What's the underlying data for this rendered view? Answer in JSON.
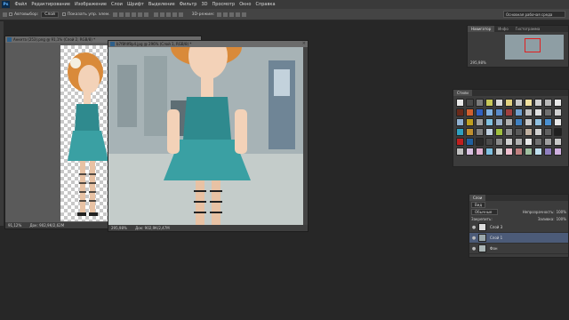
{
  "app": {
    "logo": "Ps"
  },
  "menu": [
    "Файл",
    "Редактирование",
    "Изображение",
    "Слои",
    "Шрифт",
    "Выделение",
    "Фильтр",
    "3D",
    "Просмотр",
    "Окно",
    "Справка"
  ],
  "options": {
    "autoselect_label": "Автовыбор:",
    "autoselect_value": "Слой",
    "transform_label": "Показать упр. элем.",
    "mode_3d": "3D-режим:",
    "workspace": "Основная рабочая среда"
  },
  "doc_back": {
    "title": "Анкета (253).png @ 91,1% (Слой 2, RGB/8) *",
    "zoom": "91,12%",
    "info": "Док: 902,9К/2,62М"
  },
  "doc_front": {
    "title": "b7f8fdf8p4.jpg @ 296% (Слой 1, RGB/8) *",
    "zoom": "295,98%",
    "info": "Док: 902,9К/2,47М"
  },
  "navigator": {
    "tabs": [
      "Навигатор",
      "Инфо",
      "Гистограмма"
    ],
    "zoom": "295,98%"
  },
  "swatches": {
    "tabs": [
      "Стили"
    ],
    "colors": [
      "#e8e8e8",
      "#4a4a4a",
      "#7a7a7a",
      "#c8c85a",
      "#d8d8d8",
      "#e0d080",
      "#c8c8c8",
      "#f0e0a0",
      "#d0d0d0",
      "#b8b8b8",
      "#e8e8e8",
      "#6a2a1a",
      "#d06030",
      "#3060c0",
      "#80b0e0",
      "#5a8ac8",
      "#a04040",
      "#70a0d0",
      "#c0c0c0",
      "#e0e0e0",
      "#707070",
      "#d0d0d0",
      "#90b0d0",
      "#c0a020",
      "#a0a0a0",
      "#80c0e0",
      "#9ab0c8",
      "#b0b0b0",
      "#4080c0",
      "#c8c8c8",
      "#90c0e0",
      "#4a90d0",
      "#e8e8e8",
      "#30a0c0",
      "#c09030",
      "#808080",
      "#c0d0e0",
      "#a0c040",
      "#909090",
      "#5a5a5a",
      "#c0b0a0",
      "#d0d0d0",
      "#606060",
      "#202020",
      "#c02020",
      "#2060a0",
      "#2a2a2a",
      "#4a4a4a",
      "#8a8a8a",
      "#d0d0d0",
      "#b0b0b0",
      "#e8e8e8",
      "#707070",
      "#a0a0a0",
      "#c8c8c8",
      "#c0c0c0",
      "#d8c0e0",
      "#e0b0d0",
      "#80c0e0",
      "#d0d0d0",
      "#f0c0d0",
      "#c08080",
      "#a0c0a0",
      "#c0e0f0",
      "#9080c0",
      "#d0b0e0"
    ]
  },
  "layers": {
    "tabs": [
      "Слои"
    ],
    "filter": "Вид",
    "blend": "Обычные",
    "opacity_label": "Непрозрачность:",
    "opacity_value": "100%",
    "lock_label": "Закрепить:",
    "fill_label": "Заливка:",
    "fill_value": "100%",
    "rows": [
      {
        "name": "Слой 3"
      },
      {
        "name": "Слой 1"
      },
      {
        "name": "Фон"
      }
    ]
  }
}
